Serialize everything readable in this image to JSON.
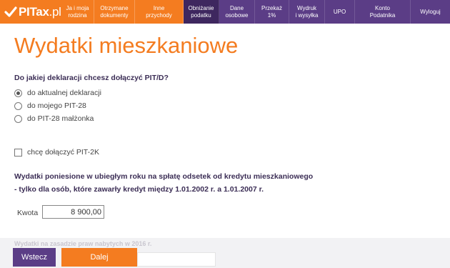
{
  "brand": {
    "name": "PITax",
    "suffix": ".pl"
  },
  "nav": {
    "items": [
      {
        "label": "Ja i moja\nrodzina"
      },
      {
        "label": "Otrzymane\ndokumenty"
      },
      {
        "label": "Inne\nprzychody"
      },
      {
        "label": "Obniżanie\npodatku"
      },
      {
        "label": "Dane\nosobowe"
      },
      {
        "label": "Przekaż\n1%"
      },
      {
        "label": "Wydruk\ni wysyłka"
      },
      {
        "label": "UPO"
      },
      {
        "label": "Konto\nPodatnika"
      },
      {
        "label": "Wyloguj"
      }
    ],
    "active_index": 3
  },
  "page": {
    "title": "Wydatki mieszkaniowe"
  },
  "declaration": {
    "question": "Do jakiej deklaracji chcesz dołączyć PIT/D?",
    "options": [
      {
        "label": "do aktualnej deklaracji",
        "checked": true
      },
      {
        "label": "do mojego PIT-28",
        "checked": false
      },
      {
        "label": "do PIT-28 małżonka",
        "checked": false
      }
    ]
  },
  "pit2k": {
    "label": "chcę dołączyć PIT-2K",
    "checked": false
  },
  "expenses": {
    "heading_line1": "Wydatki poniesione w ubiegłym roku na spłatę odsetek od kredytu mieszkaniowego",
    "heading_line2": "- tylko dla osób, które zawarły kredyt między 1.01.2002 r. a 1.01.2007 r.",
    "amount_label": "Kwota",
    "amount_value": "8 900,00"
  },
  "next_section": {
    "heading": "Wydatki na zasadzie praw nabytych w 2016 r."
  },
  "buttons": {
    "back": "Wstecz",
    "next": "Dalej"
  },
  "colors": {
    "orange": "#f47c20",
    "purple": "#5b3d86",
    "active_nav": "#3e275f"
  }
}
